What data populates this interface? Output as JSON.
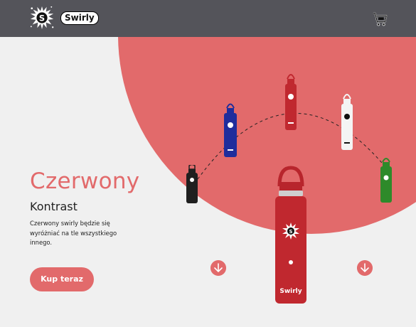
{
  "header": {
    "logo_letter": "S",
    "brand_name": "Swirly",
    "cart_icon": "shopping-cart-icon"
  },
  "hero": {
    "title": "Czerwony",
    "subtitle": "Kontrast",
    "description": "Czerwony swirly będzie się wyróżniać na tle wszystkiego innego.",
    "cta_label": "Kup teraz"
  },
  "bottle_label": "Swirly",
  "colors": {
    "header_bg": "#54545a",
    "accent": "#e26a6b",
    "page_bg": "#f0f0f0",
    "bottle_red": "#c0282f",
    "bottle_blue": "#1f2d9c",
    "bottle_white": "#f4f4f4",
    "bottle_green": "#2e8a2a",
    "bottle_black": "#1f1f1f"
  },
  "carousel": {
    "variants": [
      "black",
      "blue",
      "red",
      "white",
      "green"
    ],
    "featured": "red",
    "prev_icon": "arrow-down-icon",
    "next_icon": "arrow-down-icon"
  }
}
